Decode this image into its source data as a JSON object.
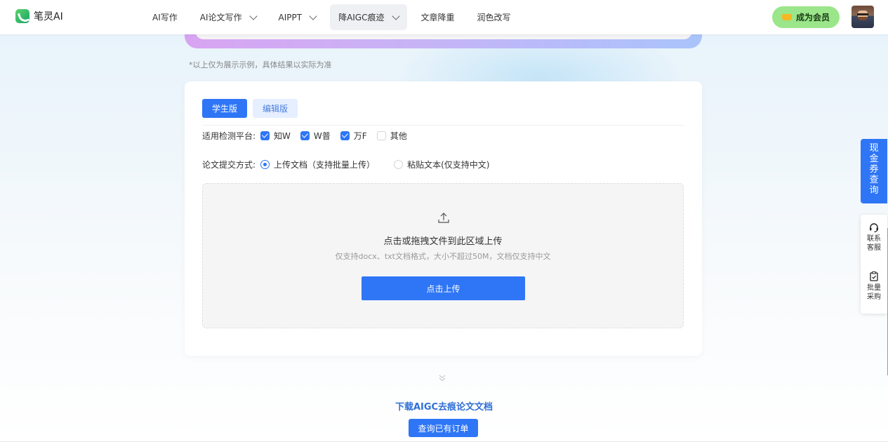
{
  "header": {
    "logo_text": "笔灵AI",
    "nav": [
      {
        "label": "AI写作"
      },
      {
        "label": "AI论文写作"
      },
      {
        "label": "AIPPT"
      },
      {
        "label": "降AIGC痕迹"
      },
      {
        "label": "文章降重"
      },
      {
        "label": "润色改写"
      }
    ],
    "vip_label": "成为会员"
  },
  "note": "*以上仅为展示示例，具体结果以实际为准",
  "card": {
    "tabs": [
      "学生版",
      "编辑版"
    ],
    "platform_label": "适用检测平台:",
    "platforms": [
      {
        "label": "知W",
        "checked": true
      },
      {
        "label": "W普",
        "checked": true
      },
      {
        "label": "万F",
        "checked": true
      },
      {
        "label": "其他",
        "checked": false
      }
    ],
    "submit_label": "论文提交方式:",
    "submit_options": [
      {
        "label": "上传文档（支持批量上传）",
        "selected": true
      },
      {
        "label": "粘贴文本(仅支持中文)",
        "selected": false
      }
    ],
    "dropzone": {
      "title": "点击或拖拽文件到此区域上传",
      "subtitle": "仅支持docx、txt文档格式，大小不超过50M，文档仅支持中文",
      "button": "点击上传"
    }
  },
  "bottom": {
    "download_title": "下载AIGC去痕论文文档",
    "order_button": "查询已有订单"
  },
  "side": {
    "coupon": "现金券查询",
    "service": "联系客服",
    "bulk": "批量采购"
  },
  "colors": {
    "accent": "#2f76f6",
    "vip": "#9be58a"
  }
}
